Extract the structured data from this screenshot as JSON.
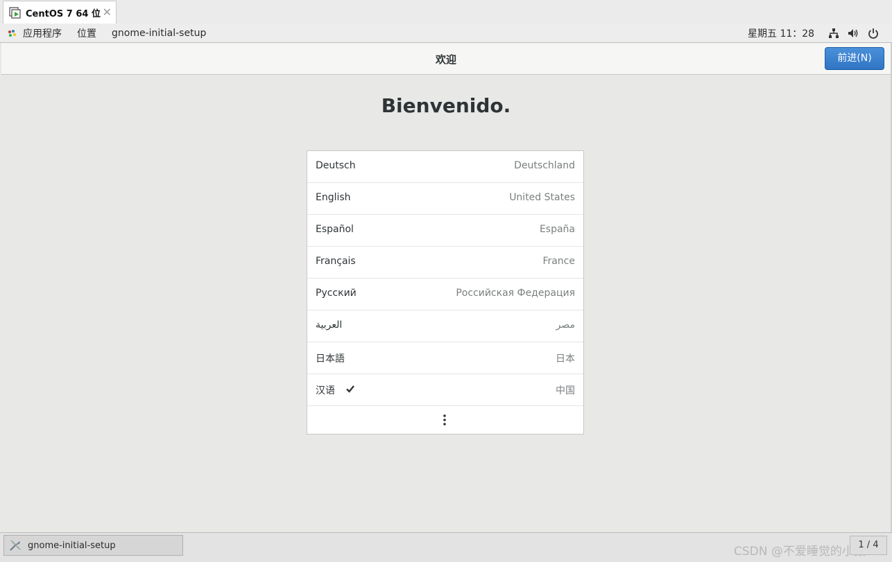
{
  "vm_tab": {
    "label": "CentOS 7 64 位",
    "close": "✕"
  },
  "top_panel": {
    "applications": "应用程序",
    "places": "位置",
    "app_name": "gnome-initial-setup",
    "clock": "星期五 11：28"
  },
  "header": {
    "title": "欢迎",
    "next_label": "前进(N)"
  },
  "main": {
    "welcome": "Bienvenido.",
    "languages": [
      {
        "name": "Deutsch",
        "region": "Deutschland"
      },
      {
        "name": "English",
        "region": "United States"
      },
      {
        "name": "Español",
        "region": "España"
      },
      {
        "name": "Français",
        "region": "France"
      },
      {
        "name": "Русский",
        "region": "Российская Федерация"
      },
      {
        "name": "العربية",
        "region": "مصر"
      },
      {
        "name": "日本語",
        "region": "日本"
      },
      {
        "name": "汉语",
        "region": "中国",
        "selected": true
      }
    ]
  },
  "taskbar": {
    "window_label": "gnome-initial-setup",
    "workspace": "1 / 4",
    "watermark": "CSDN @不爱睡觉的小猿"
  },
  "colors": {
    "accent": "#3584e4",
    "background": "#e8e8e7"
  }
}
